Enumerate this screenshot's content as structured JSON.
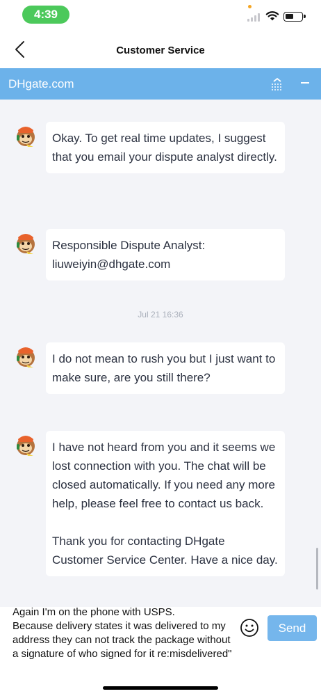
{
  "status_bar": {
    "time": "4:39"
  },
  "nav": {
    "title": "Customer Service",
    "back_icon": "chevron-left-icon"
  },
  "brand_bar": {
    "name": "DHgate.com",
    "collapse_icon": "collapse-icon",
    "minimize_icon": "minus-icon",
    "color": "#6cb2ea"
  },
  "messages": [
    {
      "sender": "agent",
      "avatar": "monkey-agent-avatar",
      "text": "Okay. To get real time updates, I suggest that you email your dispute analyst directly."
    },
    {
      "sender": "agent",
      "avatar": "monkey-agent-avatar",
      "text": "Responsible Dispute Analyst: liuweiyin@dhgate.com"
    },
    {
      "sender": "agent",
      "avatar": "monkey-agent-avatar",
      "text": "I do not mean to rush you but I just want to make sure, are you still there?"
    },
    {
      "sender": "agent",
      "avatar": "monkey-agent-avatar",
      "text": "I have not heard from you and it seems we lost connection with you. The chat will be closed automatically. If you need any more help, please feel free to contact us back.\n\nThank you for contacting DHgate Customer Service Center. Have a nice day."
    }
  ],
  "timestamp": "Jul 21 16:36",
  "input": {
    "value": "Again I'm on the phone with USPS.\nBecause delivery states it was delivered to my address they can not track the package without a signature of who signed for it re:misdelivered\"",
    "emoji_icon": "smiley-icon",
    "send_label": "Send",
    "send_color": "#75b6ec"
  }
}
